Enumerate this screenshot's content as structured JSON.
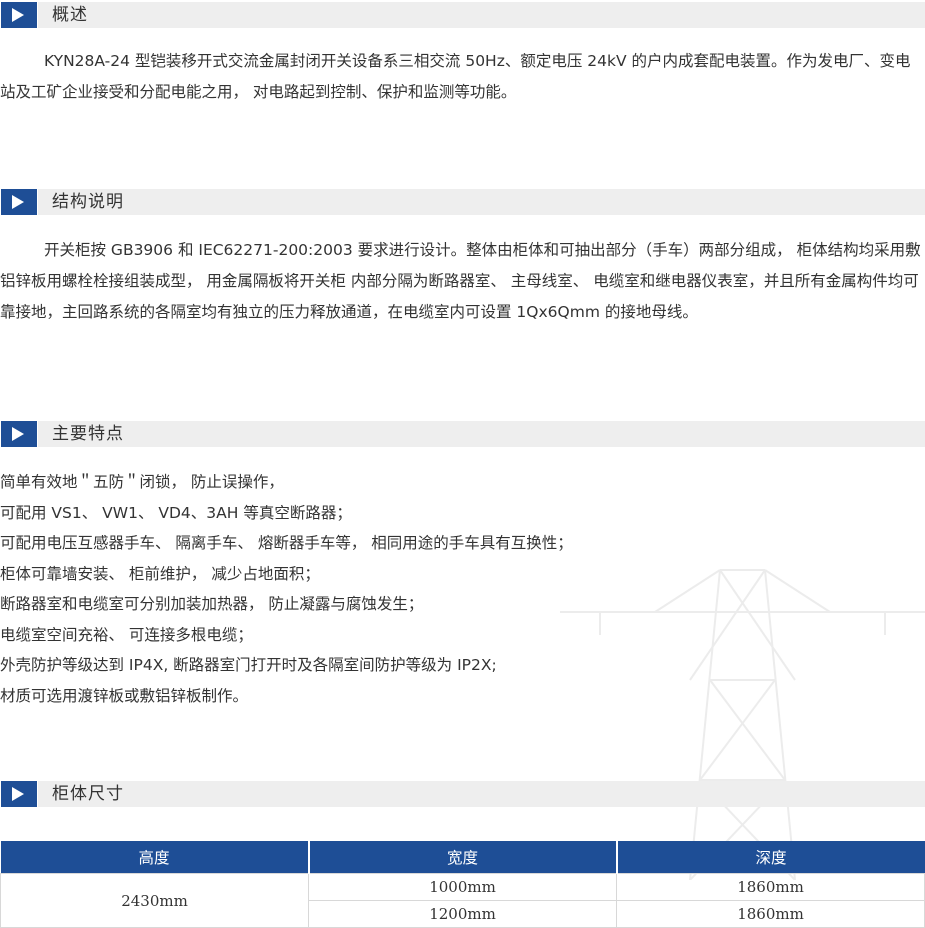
{
  "sections": {
    "overview": {
      "title": "概述",
      "text": "KYN28A-24 型铠装移开式交流金属封闭开关设备系三相交流 50Hz、额定电压 24kV 的户内成套配电装置。作为发电厂、变电站及工矿企业接受和分配电能之用， 对电路起到控制、保护和监测等功能。"
    },
    "structure": {
      "title": "结构说明",
      "text": "开关柜按 GB3906 和 IEC62271-200:2003 要求进行设计。整体由柜体和可抽出部分（手车）两部分组成， 柜体结构均采用敷铝锌板用螺栓栓接组装成型， 用金属隔板将开关柜 内部分隔为断路器室、 主母线室、 电缆室和继电器仪表室，并且所有金属构件均可靠接地，主回路系统的各隔室均有独立的压力释放通道，在电缆室内可设置 1Qx6Qmm 的接地母线。"
    },
    "features": {
      "title": "主要特点",
      "items": [
        "简单有效地＂五防＂闭锁， 防止误操作，",
        "可配用 VS1、 VW1、 VD4、3AH 等真空断路器；",
        "可配用电压互感器手车、 隔离手车、 熔断器手车等， 相同用途的手车具有互换性；",
        "柜体可靠墙安装、 柜前维护， 减少占地面积；",
        "断路器室和电缆室可分别加装加热器， 防止凝露与腐蚀发生；",
        "电缆室空间充裕、 可连接多根电缆；",
        "外壳防护等级达到 IP4X, 断路器室门打开时及各隔室间防护等级为 IP2X;",
        "材质可选用渡锌板或敷铝锌板制作。"
      ]
    },
    "dimensions": {
      "title": "柜体尺寸",
      "headers": [
        "高度",
        "宽度",
        "深度"
      ],
      "height": "2430mm",
      "rows": [
        {
          "width": "1000mm",
          "depth": "1860mm"
        },
        {
          "width": "1200mm",
          "depth": "1860mm"
        }
      ]
    }
  },
  "icons": {
    "section_marker": "play-triangle-icon",
    "background": "transmission-tower-icon"
  },
  "colors": {
    "accent": "#1e4e96",
    "header_bg": "#eeeeee",
    "text": "#333333"
  }
}
